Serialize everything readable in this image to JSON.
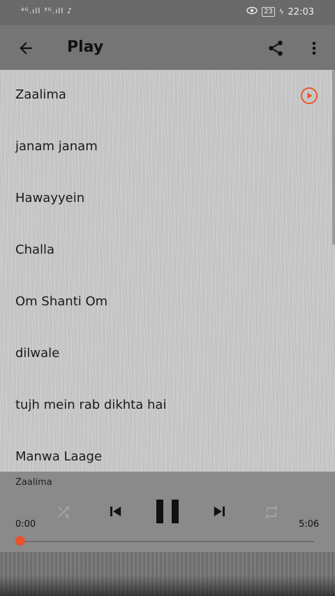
{
  "status_bar": {
    "signal_text": "⁴ᴳ.ıll ³ᴳ.ıll ♪",
    "battery": "23",
    "time": "22:03"
  },
  "app_bar": {
    "title": "Play"
  },
  "songs": [
    {
      "label": "Zaalima",
      "playing": true
    },
    {
      "label": "janam janam"
    },
    {
      "label": "Hawayyein"
    },
    {
      "label": "Challa"
    },
    {
      "label": "Om Shanti Om"
    },
    {
      "label": "dilwale"
    },
    {
      "label": "tujh mein rab dikhta hai"
    },
    {
      "label": "Manwa Laage"
    }
  ],
  "player": {
    "now_playing": "Zaalima",
    "current_time": "0:00",
    "total_time": "5:06",
    "progress_percent": 0
  },
  "colors": {
    "accent": "#e8542d",
    "app_bar": "#757575",
    "status_bar": "#6a6a6a",
    "list_bg": "#c9c9c9",
    "player_bg": "#8a8a8a"
  },
  "icons": {
    "back": "arrow-left-icon",
    "share": "share-icon",
    "menu": "more-vert-icon",
    "play": "play-circle-icon",
    "shuffle": "shuffle-icon",
    "prev": "skip-previous-icon",
    "pause": "pause-icon",
    "next": "skip-next-icon",
    "repeat": "repeat-icon"
  }
}
